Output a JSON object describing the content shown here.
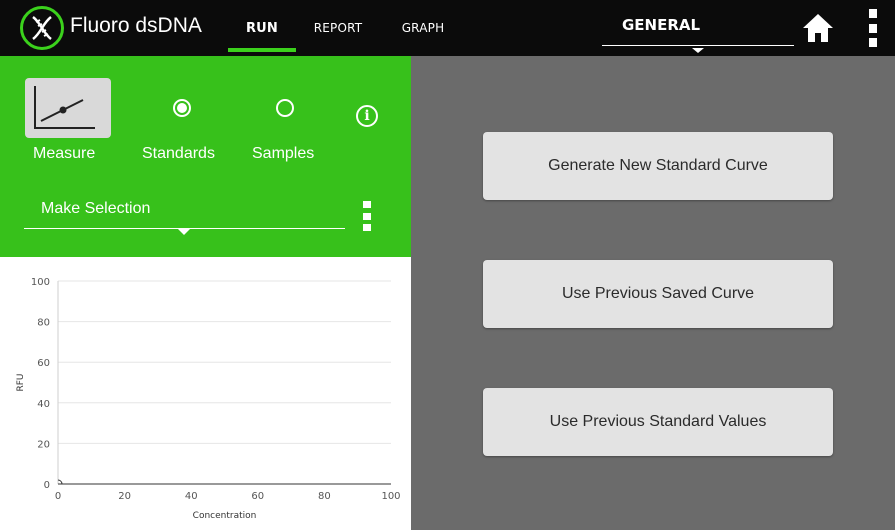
{
  "app": {
    "title": "Fluoro dsDNA",
    "logo_icon": "dna-helix-icon"
  },
  "tabs": [
    {
      "label": "RUN",
      "active": true
    },
    {
      "label": "REPORT",
      "active": false
    },
    {
      "label": "GRAPH",
      "active": false
    }
  ],
  "header": {
    "mode_dropdown": "GENERAL",
    "home_icon": "home-icon",
    "menu_icon": "more-vert-icon"
  },
  "panel": {
    "measure_label": "Measure",
    "standards_label": "Standards",
    "samples_label": "Samples",
    "selected_mode": "Standards",
    "info_icon": "info-icon",
    "selection_text": "Make Selection"
  },
  "actions": {
    "generate_label": "Generate New Standard Curve",
    "saved_curve_label": "Use Previous Saved Curve",
    "standard_values_label": "Use Previous Standard Values"
  },
  "colors": {
    "topbar": "#0b0b0b",
    "accent_green": "#37c11b",
    "background": "#6b6b6b",
    "button": "#e3e3e3"
  },
  "chart_data": {
    "type": "scatter",
    "title": "",
    "xlabel": "Concentration",
    "ylabel": "RFU",
    "xlim": [
      0,
      100
    ],
    "ylim": [
      0,
      100
    ],
    "x_ticks": [
      "0",
      "20",
      "40",
      "60",
      "80",
      "100"
    ],
    "y_ticks": [
      "0",
      "20",
      "40",
      "60",
      "80",
      "100"
    ],
    "grid": true,
    "series": [
      {
        "x": [
          0
        ],
        "y": [
          0
        ]
      }
    ]
  }
}
